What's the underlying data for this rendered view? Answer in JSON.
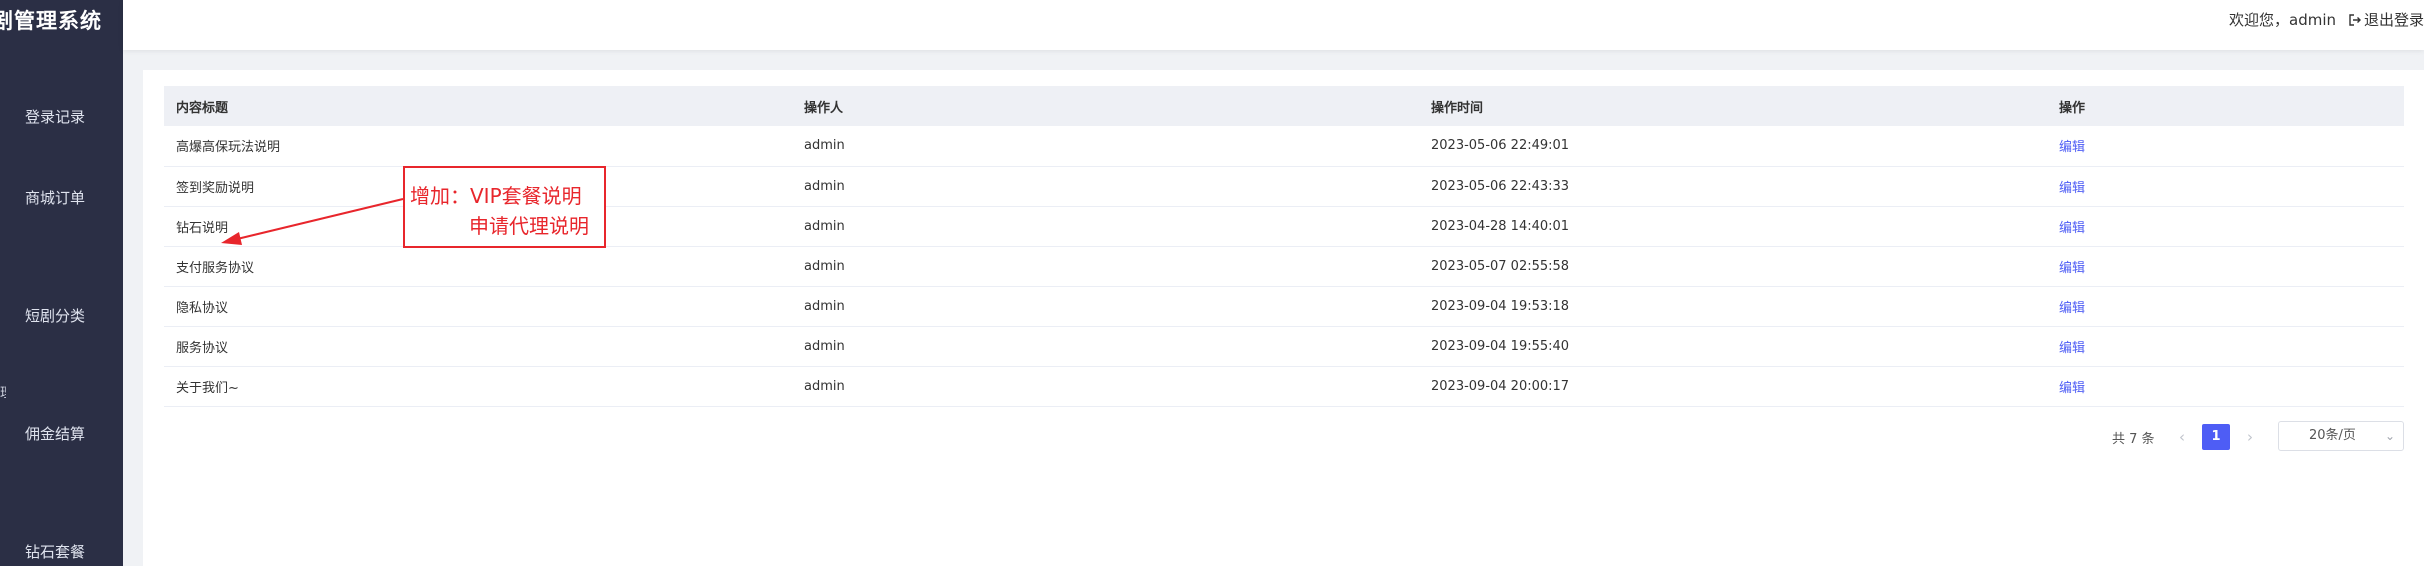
{
  "app": {
    "title": "短剧管理系统",
    "title_visible": "剧管理系统"
  },
  "sidebar": {
    "items": [
      {
        "label": "登录记录"
      },
      {
        "label": "商城订单"
      },
      {
        "label": "短剧分类"
      },
      {
        "label": "佣金结算"
      },
      {
        "label": "钻石套餐"
      }
    ],
    "edge_mark": "理"
  },
  "header": {
    "welcome": "欢迎您，admin",
    "logout_label": "退出登录",
    "logout_icon": "logout-icon"
  },
  "table": {
    "columns": [
      "内容标题",
      "操作人",
      "操作时间",
      "操作"
    ],
    "rows": [
      {
        "title": "高爆高保玩法说明",
        "operator": "admin",
        "time": "2023-05-06 22:49:01",
        "action": "编辑"
      },
      {
        "title": "签到奖励说明",
        "operator": "admin",
        "time": "2023-05-06 22:43:33",
        "action": "编辑"
      },
      {
        "title": "钻石说明",
        "operator": "admin",
        "time": "2023-04-28 14:40:01",
        "action": "编辑"
      },
      {
        "title": "支付服务协议",
        "operator": "admin",
        "time": "2023-05-07 02:55:58",
        "action": "编辑"
      },
      {
        "title": "隐私协议",
        "operator": "admin",
        "time": "2023-09-04 19:53:18",
        "action": "编辑"
      },
      {
        "title": "服务协议",
        "operator": "admin",
        "time": "2023-09-04 19:55:40",
        "action": "编辑"
      },
      {
        "title": "关于我们~",
        "operator": "admin",
        "time": "2023-09-04 20:00:17",
        "action": "编辑"
      }
    ]
  },
  "pagination": {
    "total_text": "共 7 条",
    "prev": "‹",
    "current_page": "1",
    "next": "›",
    "page_size": "20条/页",
    "chevron": "⌄"
  },
  "annotation": {
    "line1": "增加：VIP套餐说明",
    "line2": "申请代理说明",
    "color": "#e8262c"
  },
  "colors": {
    "sidebar_bg": "#2b2f45",
    "accent": "#4e5df5",
    "table_header_bg": "#eef0f5"
  }
}
